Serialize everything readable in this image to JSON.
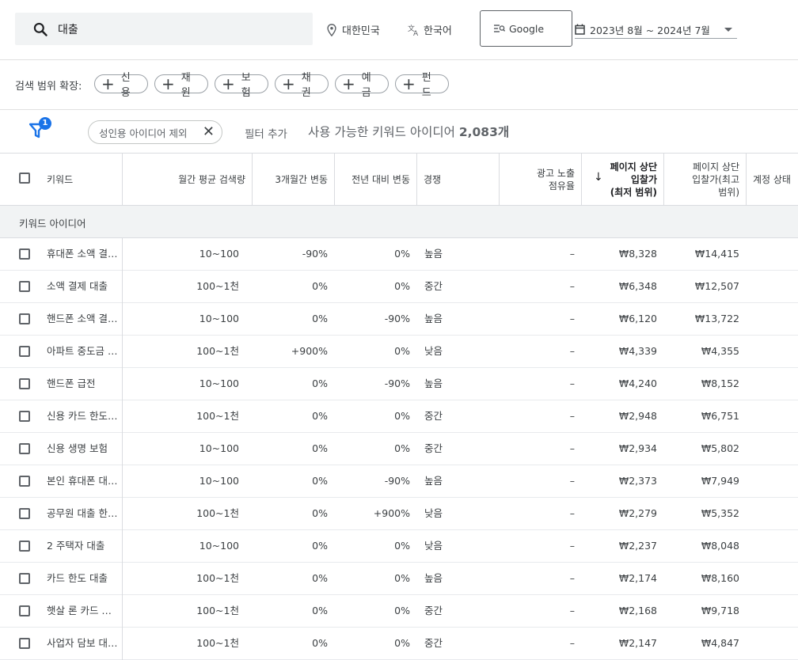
{
  "search": {
    "query": "대출"
  },
  "location": {
    "label": "대한민국"
  },
  "language": {
    "label": "한국어"
  },
  "network": {
    "label": "Google"
  },
  "date_range": {
    "label": "2023년 8월 ~ 2024년 7월"
  },
  "broaden": {
    "label": "검색 범위 확장:",
    "chips": [
      "신용",
      "재원",
      "보험",
      "채권",
      "예금",
      "펀드"
    ]
  },
  "filters": {
    "badge_count": "1",
    "active_filter": "성인용 아이디어 제외",
    "add_filter": "필터 추가",
    "available_prefix": "사용 가능한 키워드 아이디어",
    "available_count": "2,083개"
  },
  "table": {
    "headers": {
      "keyword": "키워드",
      "avg_monthly": "월간 평균 검색량",
      "three_month": "3개월간 변동",
      "yoy": "전년 대비 변동",
      "competition": "경쟁",
      "impression_line1": "광고 노출",
      "impression_line2": "점유율",
      "bid_low_line1": "페이지 상단",
      "bid_low_line2": "입찰가",
      "bid_low_line3": "(최저 범위)",
      "bid_high_line1": "페이지 상단",
      "bid_high_line2": "입찰가(최고",
      "bid_high_line3": "범위)",
      "account_status": "계정 상태"
    },
    "group_label": "키워드 아이디어",
    "rows": [
      {
        "keyword": "휴대폰 소액 결…",
        "avg": "10~100",
        "three": "-90%",
        "yoy": "0%",
        "comp": "높음",
        "imp": "–",
        "low": "₩8,328",
        "high": "₩14,415"
      },
      {
        "keyword": "소액 결제 대출",
        "avg": "100~1천",
        "three": "0%",
        "yoy": "0%",
        "comp": "중간",
        "imp": "–",
        "low": "₩6,348",
        "high": "₩12,507"
      },
      {
        "keyword": "핸드폰 소액 결…",
        "avg": "10~100",
        "three": "0%",
        "yoy": "-90%",
        "comp": "높음",
        "imp": "–",
        "low": "₩6,120",
        "high": "₩13,722"
      },
      {
        "keyword": "아파트 중도금 …",
        "avg": "100~1천",
        "three": "+900%",
        "yoy": "0%",
        "comp": "낮음",
        "imp": "–",
        "low": "₩4,339",
        "high": "₩4,355"
      },
      {
        "keyword": "핸드폰 급전",
        "avg": "10~100",
        "three": "0%",
        "yoy": "-90%",
        "comp": "높음",
        "imp": "–",
        "low": "₩4,240",
        "high": "₩8,152"
      },
      {
        "keyword": "신용 카드 한도…",
        "avg": "100~1천",
        "three": "0%",
        "yoy": "0%",
        "comp": "중간",
        "imp": "–",
        "low": "₩2,948",
        "high": "₩6,751"
      },
      {
        "keyword": "신용 생명 보험",
        "avg": "10~100",
        "three": "0%",
        "yoy": "0%",
        "comp": "중간",
        "imp": "–",
        "low": "₩2,934",
        "high": "₩5,802"
      },
      {
        "keyword": "본인 휴대폰 대…",
        "avg": "10~100",
        "three": "0%",
        "yoy": "-90%",
        "comp": "높음",
        "imp": "–",
        "low": "₩2,373",
        "high": "₩7,949"
      },
      {
        "keyword": "공무원 대출 한…",
        "avg": "100~1천",
        "three": "0%",
        "yoy": "+900%",
        "comp": "낮음",
        "imp": "–",
        "low": "₩2,279",
        "high": "₩5,352"
      },
      {
        "keyword": "2 주택자 대출",
        "avg": "10~100",
        "three": "0%",
        "yoy": "0%",
        "comp": "낮음",
        "imp": "–",
        "low": "₩2,237",
        "high": "₩8,048"
      },
      {
        "keyword": "카드 한도 대출",
        "avg": "100~1천",
        "three": "0%",
        "yoy": "0%",
        "comp": "높음",
        "imp": "–",
        "low": "₩2,174",
        "high": "₩8,160"
      },
      {
        "keyword": "햇살 론 카드 …",
        "avg": "100~1천",
        "three": "0%",
        "yoy": "0%",
        "comp": "중간",
        "imp": "–",
        "low": "₩2,168",
        "high": "₩9,718"
      },
      {
        "keyword": "사업자 담보 대…",
        "avg": "100~1천",
        "three": "0%",
        "yoy": "0%",
        "comp": "중간",
        "imp": "–",
        "low": "₩2,147",
        "high": "₩4,847"
      }
    ]
  }
}
